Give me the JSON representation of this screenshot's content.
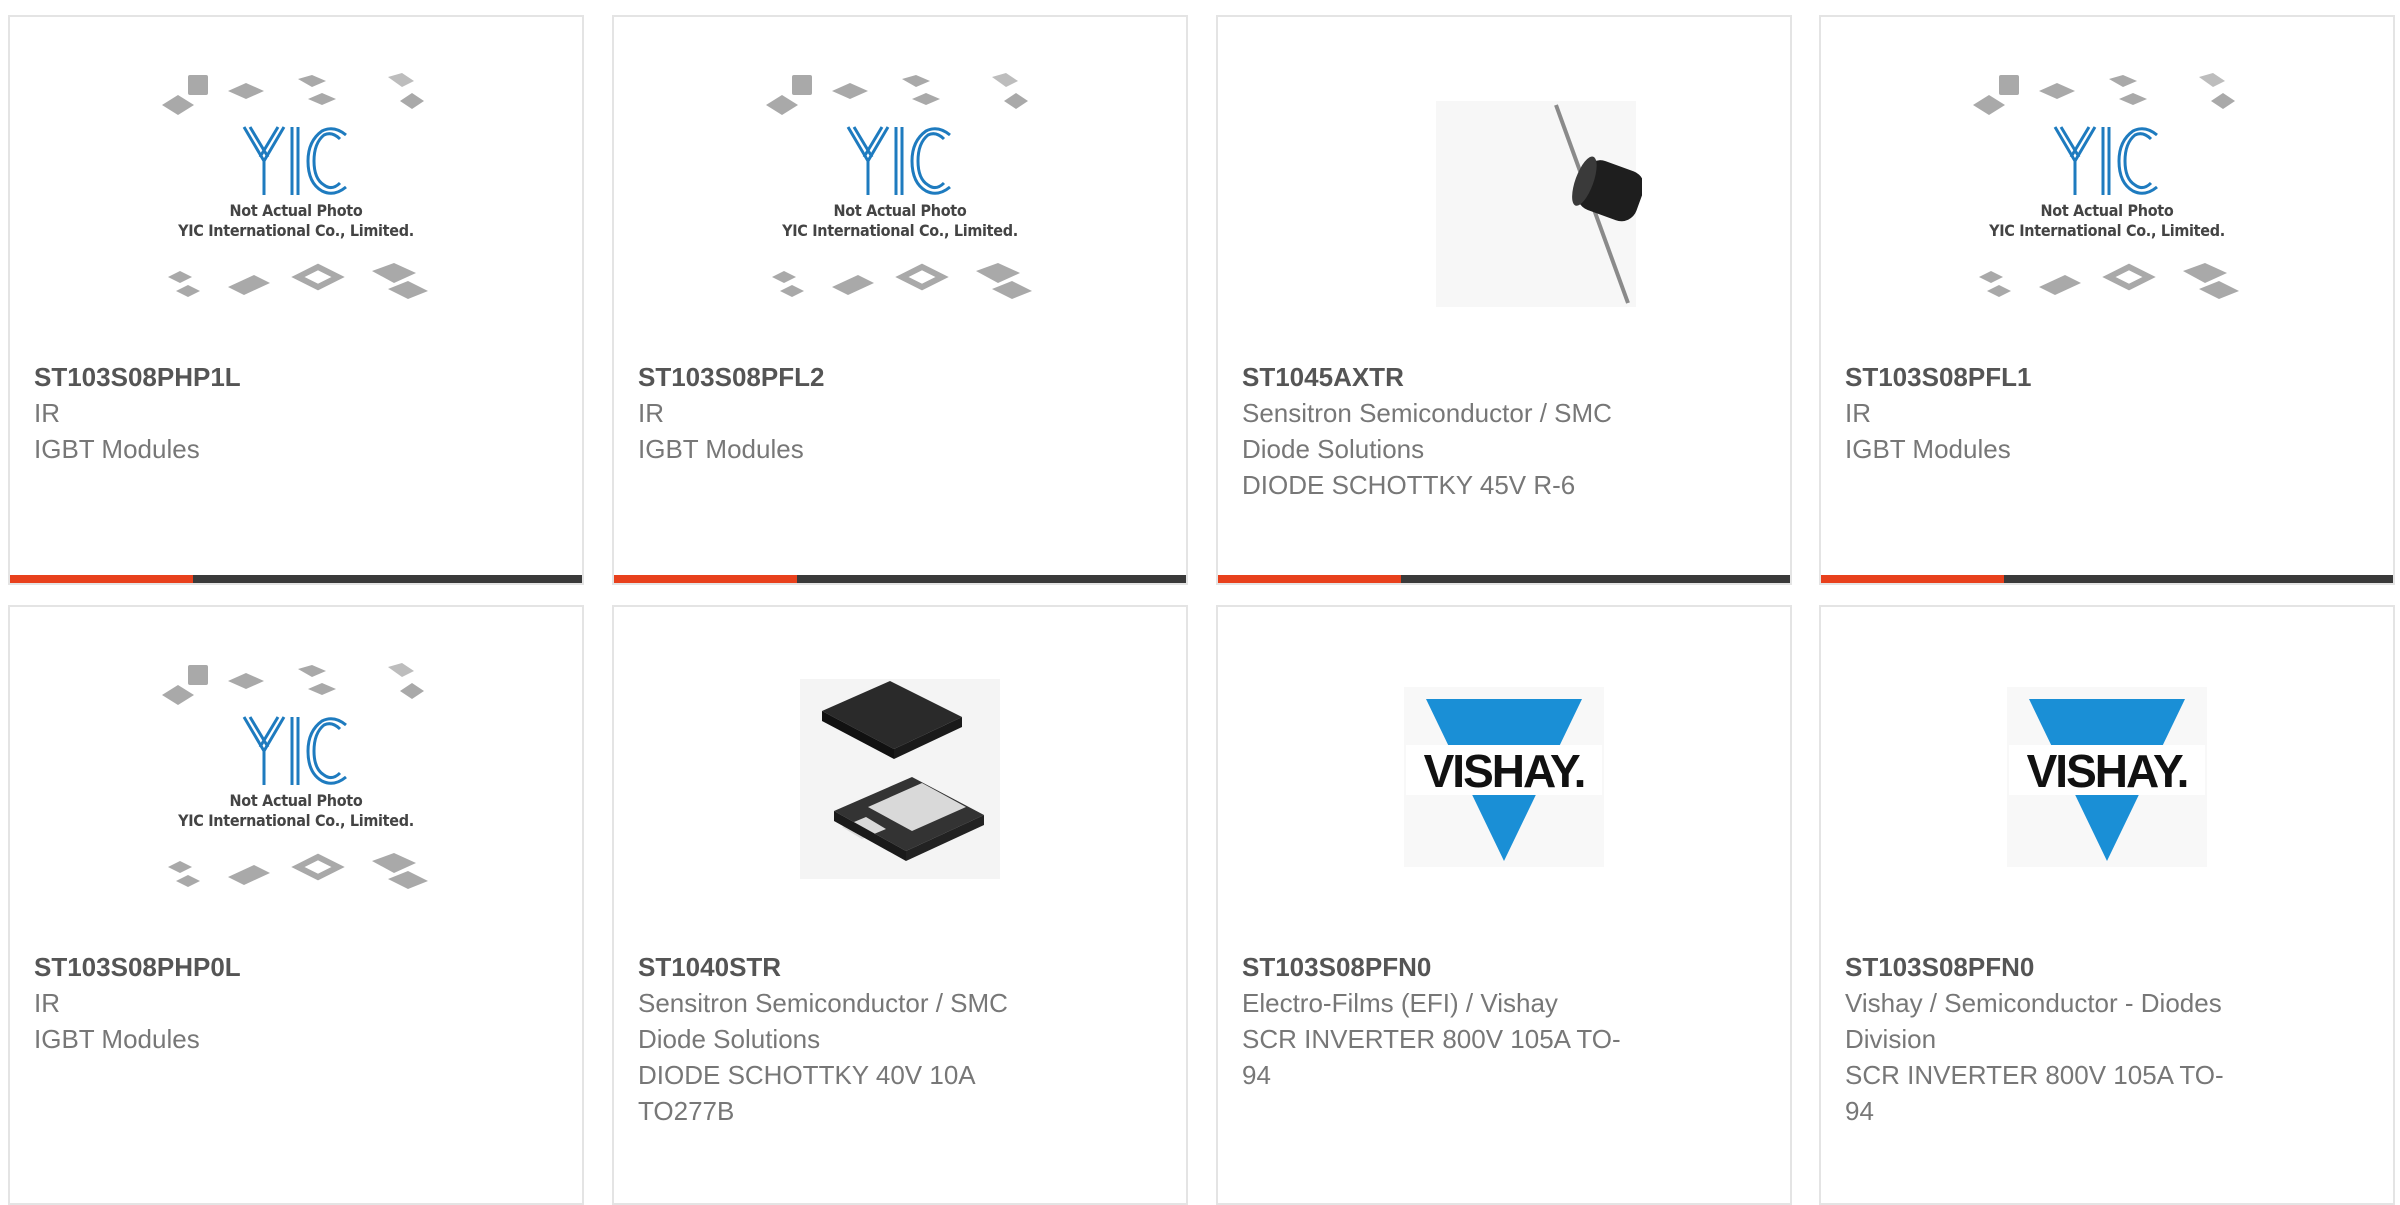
{
  "placeholder_image": {
    "logo_text": "YIC",
    "caption_line1": "Not Actual Photo",
    "caption_line2": "YIC International Co., Limited."
  },
  "colors": {
    "accent": "#e8401c",
    "bar": "#3a3a3a",
    "border": "#e4e4e4",
    "yic_blue": "#1e7bbf",
    "vishay_blue": "#1a8fd6"
  },
  "products": [
    {
      "part": "ST103S08PHP1L",
      "lines": [
        "IR",
        "IGBT Modules"
      ],
      "image": "yic-placeholder-image"
    },
    {
      "part": "ST103S08PFL2",
      "lines": [
        "IR",
        "IGBT Modules"
      ],
      "image": "yic-placeholder-image"
    },
    {
      "part": "ST1045AXTR",
      "lines": [
        "Sensitron Semiconductor / SMC",
        "Diode Solutions",
        "DIODE SCHOTTKY 45V R-6"
      ],
      "image": "axial-diode-image"
    },
    {
      "part": "ST103S08PFL1",
      "lines": [
        "IR",
        "IGBT Modules"
      ],
      "image": "yic-placeholder-image"
    },
    {
      "part": "ST103S08PHP0L",
      "lines": [
        "IR",
        "IGBT Modules"
      ],
      "image": "yic-placeholder-image"
    },
    {
      "part": "ST1040STR",
      "lines": [
        "Sensitron Semiconductor / SMC",
        "Diode Solutions",
        "DIODE SCHOTTKY 40V 10A",
        "TO277B"
      ],
      "image": "smd-diode-image"
    },
    {
      "part": "ST103S08PFN0",
      "lines": [
        "Electro-Films (EFI) / Vishay",
        "SCR INVERTER 800V 105A TO-",
        "94"
      ],
      "image": "vishay-logo-image",
      "logo_text": "VISHAY."
    },
    {
      "part": "ST103S08PFN0",
      "lines": [
        "Vishay / Semiconductor - Diodes",
        "Division",
        "SCR INVERTER 800V 105A TO-",
        "94"
      ],
      "image": "vishay-logo-image",
      "logo_text": "VISHAY."
    }
  ]
}
